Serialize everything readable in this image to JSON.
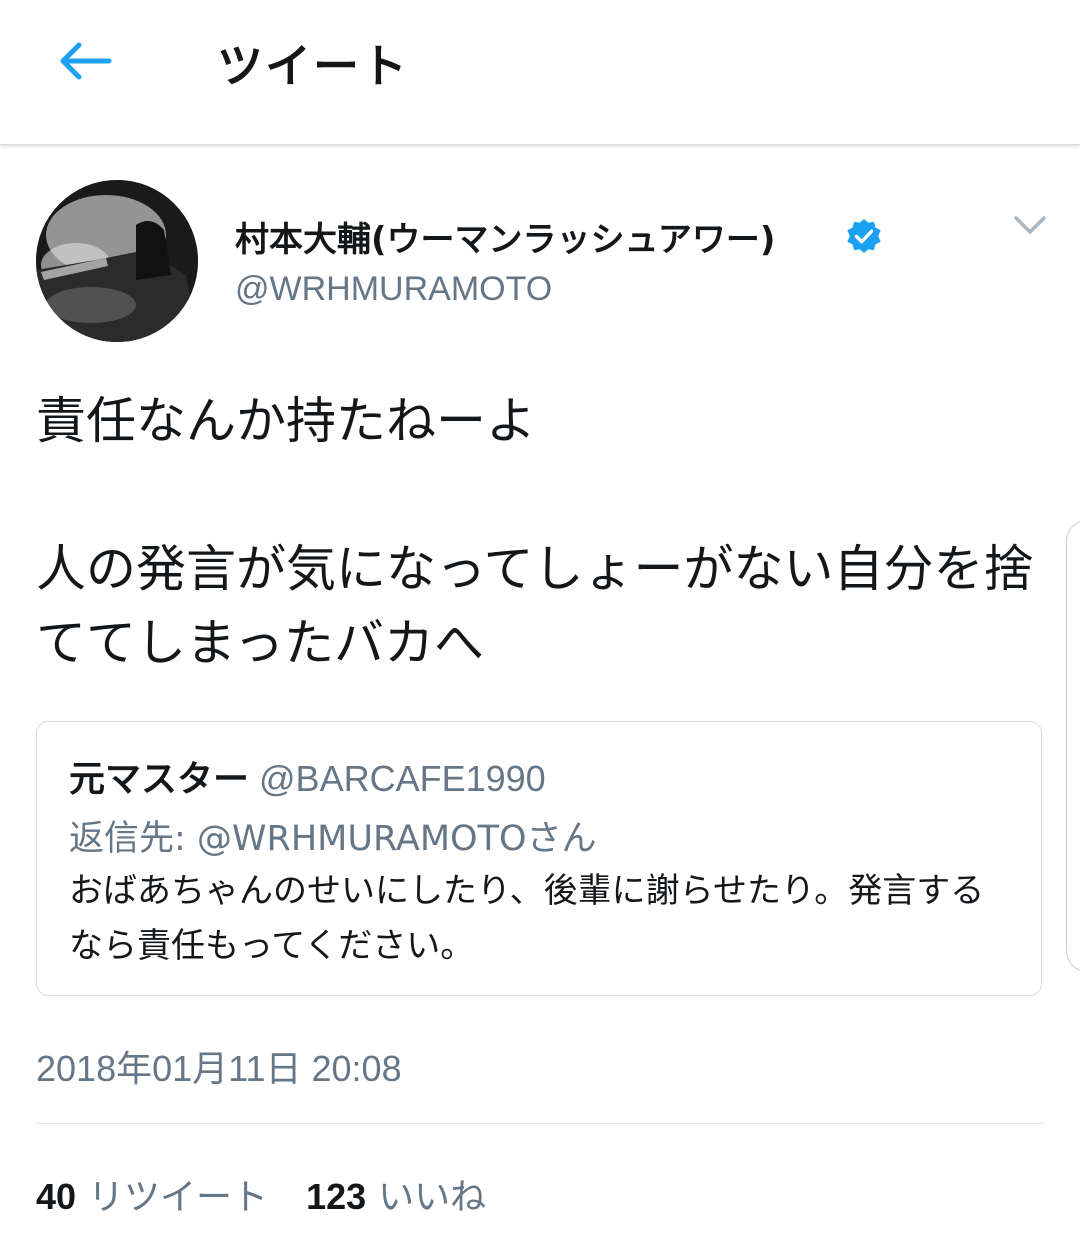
{
  "header": {
    "title": "ツイート",
    "back_icon": "arrow-left-icon"
  },
  "colors": {
    "accent": "#1DA1F2",
    "text": "#14171A",
    "secondary": "#657786"
  },
  "tweet": {
    "display_name": "村本大輔(ウーマンラッシュアワー)",
    "handle": "@WRHMURAMOTO",
    "verified_icon": "verified-badge-icon",
    "caret_icon": "chevron-down-icon",
    "text_line1": "責任なんか持たねーよ",
    "text_line2": "人の発言が気になってしょーがない自分を捨ててしまったバカへ",
    "timestamp": "2018年01月11日 20:08"
  },
  "quote": {
    "name": "元マスター",
    "handle": "@BARCAFE1990",
    "reply_to": "返信先: @WRHMURAMOTOさん",
    "text": "おばあちゃんのせいにしたり、後輩に謝らせたり。発言するなら責任もってください。"
  },
  "stats": {
    "retweets_count": "40",
    "retweets_label": "リツイート",
    "likes_count": "123",
    "likes_label": "いいね"
  }
}
